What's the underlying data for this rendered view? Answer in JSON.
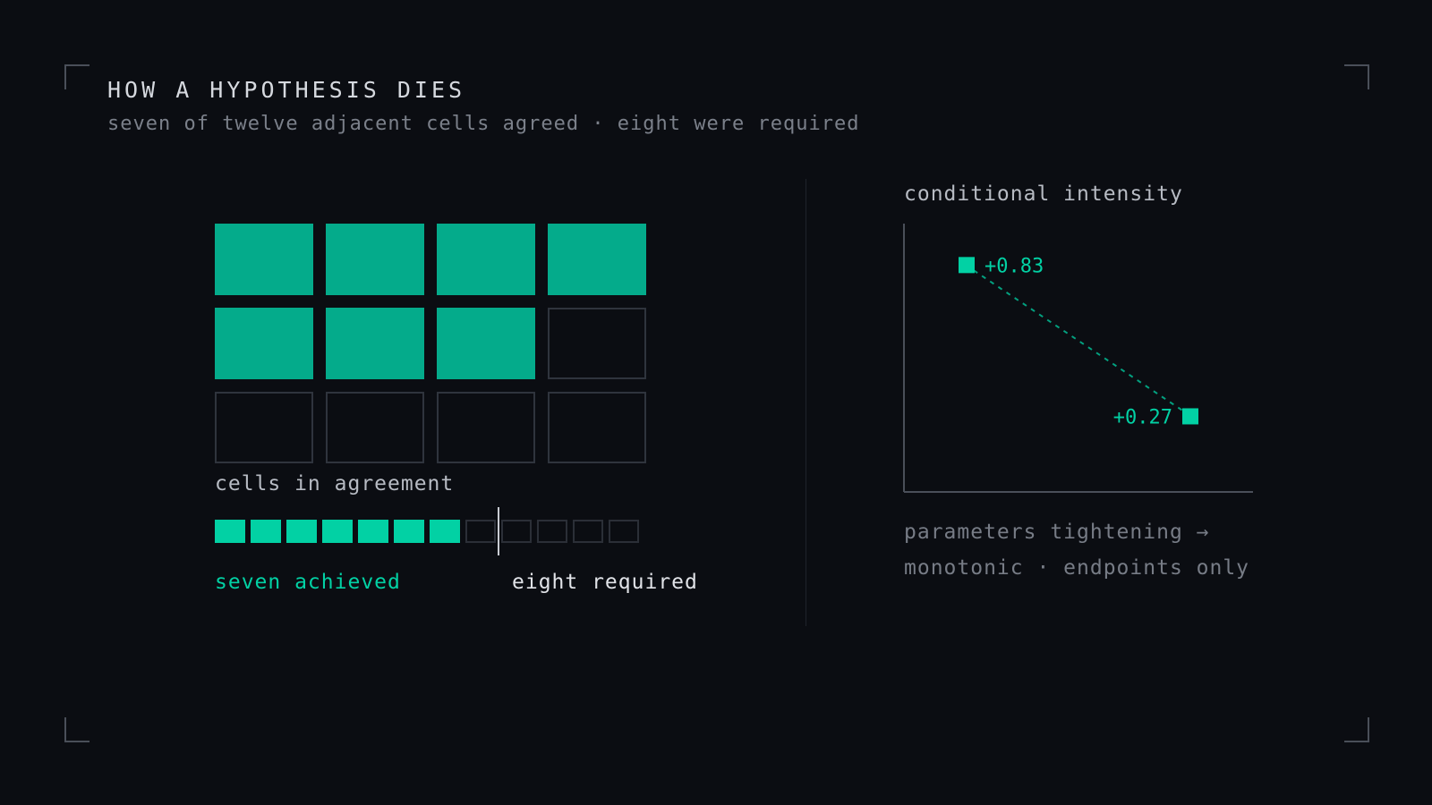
{
  "header": {
    "title": "HOW A HYPOTHESIS DIES",
    "subtitle": "seven of twelve adjacent cells agreed · eight were required"
  },
  "grid": {
    "columns": 4,
    "total_cells": 12,
    "agreeing_cells": 7,
    "colors": {
      "agree": "#04ab8b",
      "empty_border": "#2f343d"
    }
  },
  "agreement_bar": {
    "label": "cells in agreement",
    "total": 12,
    "achieved": 7,
    "required": 8,
    "achieved_label": "seven achieved",
    "required_label": "eight required",
    "colors": {
      "achieved": "#02d1a4",
      "empty_border": "#2b2f37"
    }
  },
  "chart_data": {
    "type": "scatter",
    "title": "conditional intensity",
    "xlabel": "parameters tightening →",
    "note": "monotonic · endpoints only",
    "points": [
      {
        "x": 0,
        "y": 0.83,
        "label": "+0.83"
      },
      {
        "x": 1,
        "y": 0.27,
        "label": "+0.27"
      }
    ],
    "connector": "dashed",
    "grid": false,
    "color": "#02d1a4"
  }
}
